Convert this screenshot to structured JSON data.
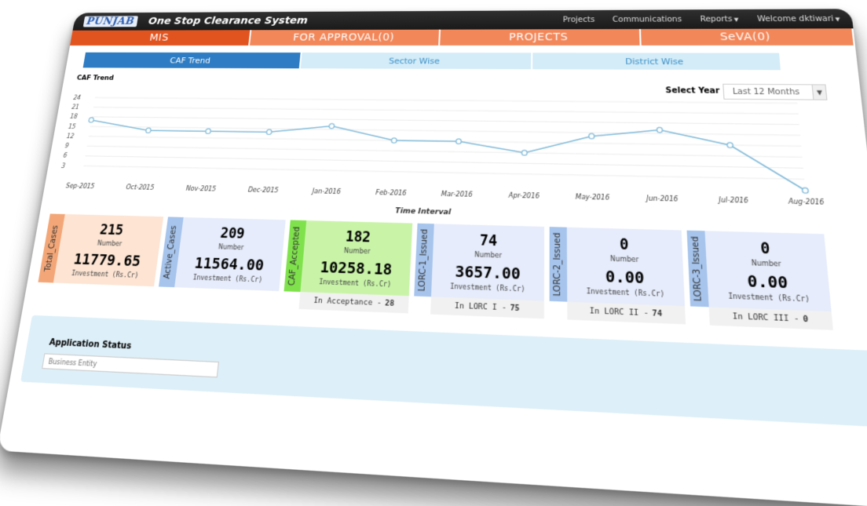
{
  "header": {
    "logo_text": "PUNJAB",
    "app_title": "One Stop Clearance System",
    "nav": {
      "projects": "Projects",
      "communications": "Communications",
      "reports": "Reports",
      "welcome": "Welcome dktiwari"
    }
  },
  "main_tabs": [
    "MIS",
    "FOR APPROVAL(0)",
    "PROJECTS",
    "SeVA(0)"
  ],
  "sub_tabs": [
    "CAF Trend",
    "Sector Wise",
    "District Wise"
  ],
  "chart_panel": {
    "title": "CAF Trend",
    "select_year_label": "Select Year",
    "select_year_value": "Last 12 Months"
  },
  "chart_data": {
    "type": "line",
    "title": "CAF Trend",
    "xlabel": "Time Interval",
    "ylabel": "",
    "categories": [
      "Sep-2015",
      "Oct-2015",
      "Nov-2015",
      "Dec-2015",
      "Jan-2016",
      "Feb-2016",
      "Mar-2016",
      "Apr-2016",
      "May-2016",
      "Jun-2016",
      "Jul-2016",
      "Aug-2016"
    ],
    "series": [
      {
        "values": [
          17,
          14,
          14,
          14,
          16,
          12,
          12,
          9,
          14,
          16,
          12,
          0
        ]
      }
    ],
    "yticks": [
      3,
      6,
      9,
      12,
      15,
      18,
      21,
      24
    ],
    "ylim": [
      0,
      24
    ],
    "color": "#7fb9d8"
  },
  "stats": [
    {
      "label": "Total_Cases",
      "number": "215",
      "number_label": "Number",
      "investment": "11779.65",
      "investment_label": "Investment (Rs.Cr)",
      "bg": "#fde4d3",
      "label_bg": "#f3a778"
    },
    {
      "label": "Active_Cases",
      "number": "209",
      "number_label": "Number",
      "investment": "11564.00",
      "investment_label": "Investment (Rs.Cr)",
      "bg": "#e6ecfb",
      "label_bg": "#a6c4ec"
    },
    {
      "label": "CAF_Accepted",
      "number": "182",
      "number_label": "Number",
      "investment": "10258.18",
      "investment_label": "Investment (Rs.Cr)",
      "bg": "#c9f4a8",
      "label_bg": "#7fe24c",
      "stage": "In Acceptance -",
      "stage_value": "28"
    },
    {
      "label": "LORC-1_Issued",
      "number": "74",
      "number_label": "Number",
      "investment": "3657.00",
      "investment_label": "Investment (Rs.Cr)",
      "bg": "#e6ecfb",
      "label_bg": "#a6c4ec",
      "stage": "In LORC I -",
      "stage_value": "75"
    },
    {
      "label": "LORC-2_Issued",
      "number": "0",
      "number_label": "Number",
      "investment": "0.00",
      "investment_label": "Investment (Rs.Cr)",
      "bg": "#e6ecfb",
      "label_bg": "#a6c4ec",
      "stage": "In LORC II -",
      "stage_value": "74"
    },
    {
      "label": "LORC-3_Issued",
      "number": "0",
      "number_label": "Number",
      "investment": "0.00",
      "investment_label": "Investment (Rs.Cr)",
      "bg": "#e6ecfb",
      "label_bg": "#a6c4ec",
      "stage": "In LORC III -",
      "stage_value": "0"
    }
  ],
  "application_status": {
    "title": "Application Status",
    "placeholder": "Business Entity"
  }
}
